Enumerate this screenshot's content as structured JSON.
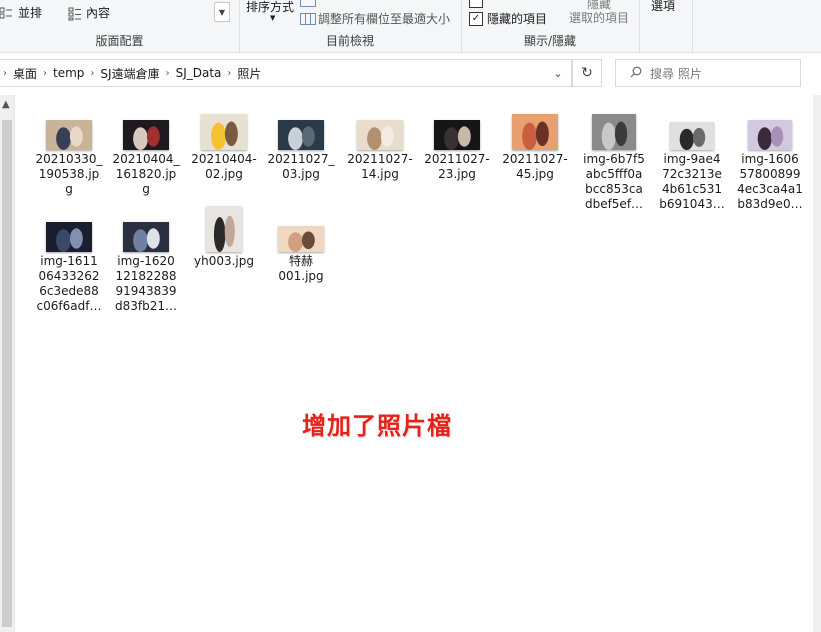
{
  "ribbon": {
    "layout_group": {
      "label": "版面配置",
      "item_tiles": "並排",
      "item_content": "內容"
    },
    "view_group": {
      "label": "目前檢視",
      "sort_by": "排序方式",
      "size_all_columns": "調整所有欄位至最適大小"
    },
    "showhide_group": {
      "label": "顯示/隱藏",
      "hidden_items": "隱藏的項目",
      "hidden_items_checked": true,
      "hide_selected_line1": "隱藏",
      "hide_selected_line2": "選取的項目"
    },
    "options_label": "選項"
  },
  "address": {
    "crumbs": [
      "桌面",
      "temp",
      "SJ遠端倉庫",
      "SJ_Data",
      "照片"
    ]
  },
  "search": {
    "placeholder": "搜尋 照片"
  },
  "files": [
    {
      "name": "20210330_190538.jpg",
      "display": "20210330_\n190538.jp\ng",
      "thumb_colors": [
        "#c9b49a",
        "#3a3f55",
        "#e8d8c8"
      ]
    },
    {
      "name": "20210404_161820.jpg",
      "display": "20210404_\n161820.jp\ng",
      "thumb_colors": [
        "#1e1a20",
        "#d8c8c0",
        "#a23030"
      ]
    },
    {
      "name": "20210404-02.jpg",
      "display": "20210404-\n02.jpg",
      "thumb_colors": [
        "#e8e0d0",
        "#f2c230",
        "#7a5a40"
      ]
    },
    {
      "name": "20211027_03.jpg",
      "display": "20211027_\n03.jpg",
      "thumb_colors": [
        "#2a3a48",
        "#c8d0d8",
        "#5a6878"
      ]
    },
    {
      "name": "20211027-14.jpg",
      "display": "20211027-\n14.jpg",
      "thumb_colors": [
        "#e8dccc",
        "#b09070",
        "#f4ece0"
      ]
    },
    {
      "name": "20211027-23.jpg",
      "display": "20211027-\n23.jpg",
      "thumb_colors": [
        "#161616",
        "#3a3030",
        "#c8b8a8"
      ]
    },
    {
      "name": "20211027-45.jpg",
      "display": "20211027-\n45.jpg",
      "thumb_colors": [
        "#e8a070",
        "#c86040",
        "#6a3028"
      ]
    },
    {
      "name": "img-6b7f5abc5fff0abcc853cadbef5ef…",
      "display": "img-6b7f5\nabc5fff0a\nbcc853ca\ndbef5ef…",
      "thumb_colors": [
        "#8a8a8a",
        "#c8c8c8",
        "#3a3a3a"
      ]
    },
    {
      "name": "img-9ae472c3213e4b61c531b691043…",
      "display": "img-9ae4\n72c3213e\n4b61c531\nb691043…",
      "thumb_colors": [
        "#e0e0e0",
        "#2a2a2a",
        "#6a6a6a"
      ]
    },
    {
      "name": "img-1606578008994ec3ca4a1b83d9e0…",
      "display": "img-1606\n57800899\n4ec3ca4a1\nb83d9e0…",
      "thumb_colors": [
        "#d4c8e0",
        "#3a2a3a",
        "#a890b8"
      ]
    },
    {
      "name": "img-1611064332626c3ede88c06f6adf…",
      "display": "img-1611\n06433262\n6c3ede88\nc06f6adf…",
      "thumb_colors": [
        "#1a1e30",
        "#3a4868",
        "#8090b0"
      ]
    },
    {
      "name": "img-162012182288919438 39d83fb21…",
      "display": "img-1620\n12182288\n91943839\nd83fb21…",
      "thumb_colors": [
        "#2a3040",
        "#7080a0",
        "#e0e0e8"
      ]
    },
    {
      "name": "yh003.jpg",
      "display": "yh003.jpg",
      "thumb_colors": [
        "#e8e4e0",
        "#2a2a2a",
        "#c0a898"
      ]
    },
    {
      "name": "特赫001.jpg",
      "display": "特赫\n001.jpg",
      "thumb_colors": [
        "#f0d8c0",
        "#d0a080",
        "#6a4a3a"
      ]
    }
  ],
  "annotation": "增加了照片檔"
}
